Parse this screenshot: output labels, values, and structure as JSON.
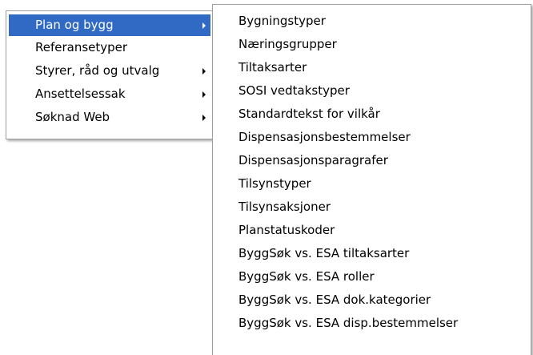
{
  "main_menu": {
    "items": [
      {
        "label": "Plan og bygg",
        "has_submenu": true,
        "highlighted": true,
        "arrow_icon": "submenu-arrow-icon"
      },
      {
        "label": "Referansetyper",
        "has_submenu": false,
        "highlighted": false
      },
      {
        "label": "Styrer, råd og utvalg",
        "has_submenu": true,
        "highlighted": false,
        "arrow_icon": "submenu-arrow-icon"
      },
      {
        "label": "Ansettelsessak",
        "has_submenu": true,
        "highlighted": false,
        "arrow_icon": "submenu-arrow-icon"
      },
      {
        "label": "Søknad Web",
        "has_submenu": true,
        "highlighted": false,
        "arrow_icon": "submenu-arrow-icon"
      }
    ]
  },
  "sub_menu": {
    "items": [
      {
        "label": "Bygningstyper"
      },
      {
        "label": "Næringsgrupper"
      },
      {
        "label": "Tiltaksarter"
      },
      {
        "label": "SOSI vedtakstyper"
      },
      {
        "label": "Standardtekst for vilkår"
      },
      {
        "label": "Dispensasjonsbestemmelser"
      },
      {
        "label": "Dispensasjonsparagrafer"
      },
      {
        "label": "Tilsynstyper"
      },
      {
        "label": "Tilsynsaksjoner"
      },
      {
        "label": "Planstatuskoder"
      },
      {
        "label": "ByggSøk vs. ESA tiltaksarter"
      },
      {
        "label": "ByggSøk vs. ESA roller"
      },
      {
        "label": "ByggSøk vs. ESA dok.kategorier"
      },
      {
        "label": "ByggSøk vs. ESA disp.bestemmelser"
      }
    ]
  },
  "colors": {
    "highlight_bg": "#316ac5",
    "highlight_text": "#ffffff",
    "menu_bg": "#ffffff",
    "menu_border": "#a0a0a0"
  }
}
